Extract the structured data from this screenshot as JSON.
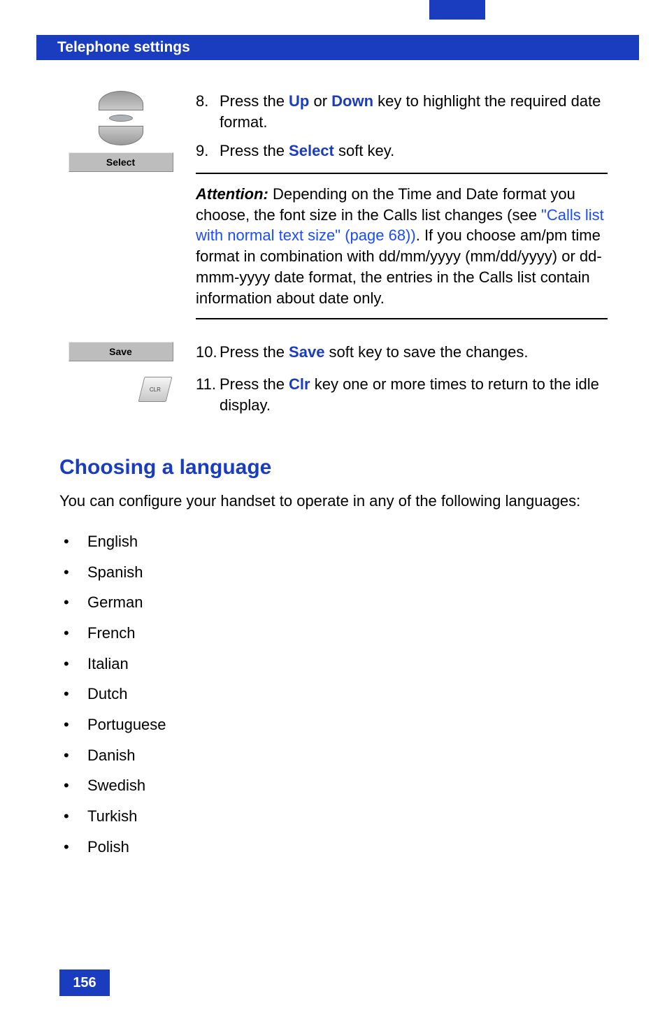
{
  "header": {
    "title": "Telephone settings"
  },
  "softkeys": {
    "select": "Select",
    "save": "Save",
    "clr": "CLR"
  },
  "steps": {
    "s8": {
      "num": "8.",
      "pre": "Press the ",
      "k1": "Up",
      "mid": " or ",
      "k2": "Down",
      "post": " key to highlight the required date format."
    },
    "s9": {
      "num": "9.",
      "pre": "Press the ",
      "k1": "Select",
      "post": " soft key."
    },
    "s10": {
      "num": "10.",
      "pre": "Press the ",
      "k1": "Save",
      "post": " soft key to save the changes."
    },
    "s11": {
      "num": "11.",
      "pre": "Press the ",
      "k1": "Clr",
      "post": " key one or more times to return to the idle display."
    }
  },
  "attention": {
    "label": "Attention:",
    "part1": " Depending on the Time and Date format you choose, the font size in the Calls list changes (see ",
    "link": "\"Calls list with normal text size\" (page 68))",
    "part2": ". If you choose am/pm time format in combination with dd/mm/yyyy (mm/dd/yyyy) or dd-mmm-yyyy date format, the entries in the Calls list contain information about date only."
  },
  "section": {
    "heading": "Choosing a language",
    "intro": "You can configure your handset to operate in any of the following languages:"
  },
  "languages": [
    "English",
    "Spanish",
    "German",
    "French",
    "Italian",
    "Dutch",
    "Portuguese",
    "Danish",
    "Swedish",
    "Turkish",
    "Polish"
  ],
  "page_number": "156"
}
